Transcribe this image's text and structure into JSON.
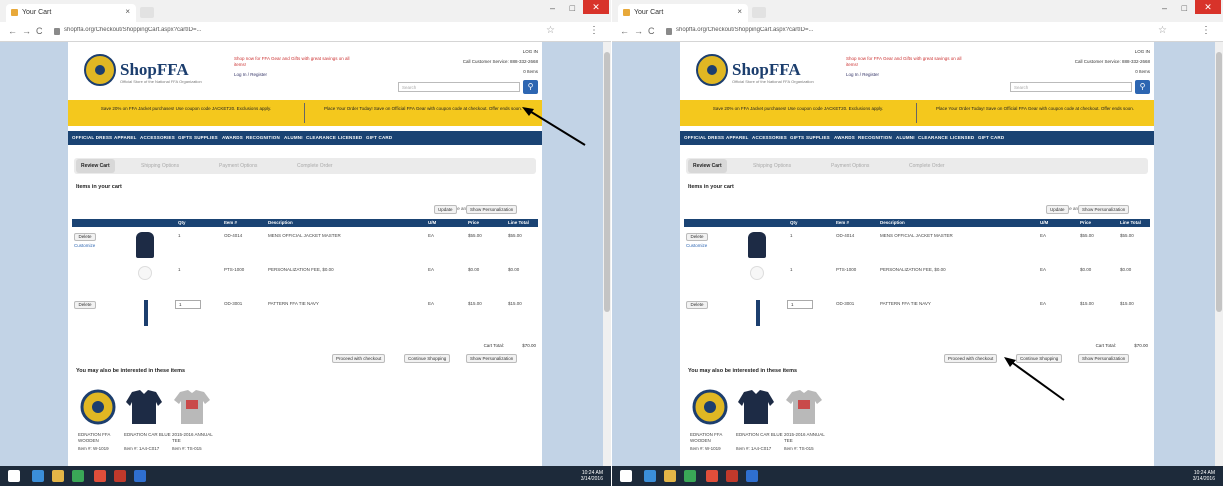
{
  "browser": {
    "tab_title": "Your Cart",
    "tab_close": "×",
    "url": "shopffa.org/Checkout/ShoppingCart.aspx?cartID=...",
    "win_min": "–",
    "win_max": "□",
    "win_close": "✕",
    "back": "←",
    "forward": "→",
    "reload": "C",
    "star": "☆",
    "menu": "⋮"
  },
  "header": {
    "logo_text": "ShopFFA",
    "logo_tagline": "Official Store of the National FFA Organization",
    "promo_red": "Shop now for FFA Gear and Gifts with great savings on all items!",
    "login": "Log In / Register",
    "hdr_line1": "LOG IN",
    "hdr_line2": "Call Customer Service: 888-332-2668",
    "hdr_line3": "0 Items",
    "search_placeholder": "Search",
    "search_icon": "magnifier-icon"
  },
  "promo_banner": {
    "left": "Save 20% on FFA Jacket purchases! Use coupon code JACKET20. Exclusions apply.",
    "right": "Place Your Order Today! Save on Official FFA Gear with coupon code at checkout. Offer ends soon."
  },
  "nav": {
    "items": [
      "OFFICIAL DRESS",
      "APPAREL",
      "ACCESSORIES",
      "GIFTS",
      "SUPPLIES",
      "AWARDS",
      "RECOGNITION",
      "ALUMNI",
      "CLEARANCE",
      "LICENSED",
      "GIFT CARD"
    ]
  },
  "steps": [
    "Review Cart",
    "Shipping Options",
    "Payment Options",
    "Complete Order"
  ],
  "cart": {
    "heading": "Items in your cart",
    "changes_prompt": "Make any changes below?",
    "update_label": "Update",
    "personalization_label": "Show Personalization",
    "columns": [
      "Qty",
      "Item #",
      "Description",
      "U/M",
      "Price",
      "Line Total"
    ],
    "rows": [
      {
        "action": "Delete",
        "link": "Customize",
        "qty": "1",
        "item": "OD-4014",
        "desc": "MENS OFFICIAL JACKET MASTER",
        "um": "EA",
        "price": "$55.00",
        "total": "$55.00"
      },
      {
        "action": "",
        "link": "",
        "qty": "1",
        "item": "PTS-1000",
        "desc": "PERSONALIZATION FEE, $0.00",
        "um": "EA",
        "price": "$0.00",
        "total": "$0.00"
      },
      {
        "action": "Delete",
        "link": "",
        "qty": "1",
        "item": "OD-3001",
        "desc": "PATTERN FFA TIE NAVY",
        "um": "EA",
        "price": "$15.00",
        "total": "$15.00"
      }
    ],
    "total_label": "Cart Total:",
    "total_value": "$70.00",
    "proceed_label": "Proceed with checkout",
    "continue_label": "Continue Shopping",
    "show_personalization_label": "Show Personalization"
  },
  "suggestions": {
    "heading": "You may also be interested in these items",
    "items": [
      {
        "name": "EDNATION FFA WOODEN",
        "item": "Item #: W-1019",
        "icon": "emblem-icon"
      },
      {
        "name": "EDNATION CAR BLUE",
        "item": "Item #: 1A4-C017",
        "icon": "jacket-icon"
      },
      {
        "name": "2015-2016 ANNUAL TEE",
        "item": "Item #: TS-015",
        "icon": "tshirt-icon"
      }
    ]
  },
  "taskbar": {
    "clock": "10:24 AM",
    "date": "3/14/2016"
  }
}
